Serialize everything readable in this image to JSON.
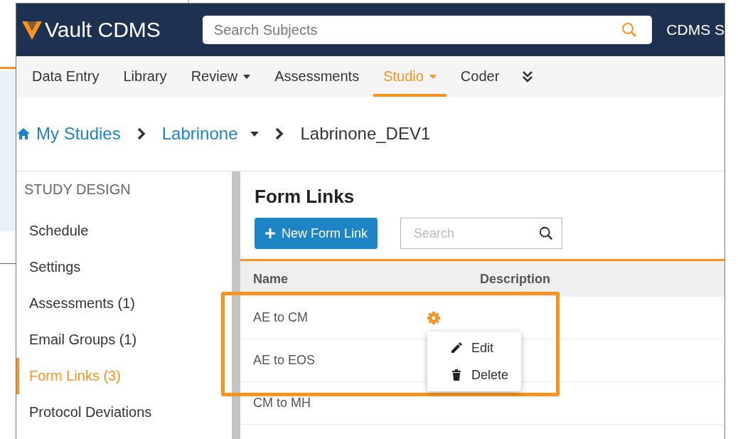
{
  "header": {
    "logo": "Vault CDMS",
    "search": {
      "placeholder": "Search Subjects"
    },
    "user_menu": "CDMS S"
  },
  "nav_tabs": [
    {
      "label": "Data Entry",
      "selected": false,
      "dropdown": false
    },
    {
      "label": "Library",
      "selected": false,
      "dropdown": false
    },
    {
      "label": "Review",
      "selected": false,
      "dropdown": true
    },
    {
      "label": "Assessments",
      "selected": false,
      "dropdown": false
    },
    {
      "label": "Studio",
      "selected": true,
      "dropdown": true
    },
    {
      "label": "Coder",
      "selected": false,
      "dropdown": false
    }
  ],
  "breadcrumb": [
    {
      "label": "My Studies",
      "kind": "home"
    },
    {
      "label": "Labrinone",
      "kind": "dropdown"
    },
    {
      "label": "Labrinone_DEV1",
      "kind": "current"
    }
  ],
  "sidebar": {
    "heading": "STUDY DESIGN",
    "items": [
      {
        "label": "Schedule",
        "selected": false
      },
      {
        "label": "Settings",
        "selected": false
      },
      {
        "label": "Assessments (1)",
        "selected": false
      },
      {
        "label": "Email Groups (1)",
        "selected": false
      },
      {
        "label": "Form Links (3)",
        "selected": true
      },
      {
        "label": "Protocol Deviations",
        "selected": false
      }
    ]
  },
  "content": {
    "title": "Form Links",
    "new_button": "New Form Link",
    "search": {
      "placeholder": "Search"
    },
    "table": {
      "columns": [
        "Name",
        "Description"
      ],
      "rows": [
        {
          "name": "AE to CM",
          "hovered": true
        },
        {
          "name": "AE to EOS",
          "hovered": false
        },
        {
          "name": "CM to MH",
          "hovered": false
        }
      ]
    },
    "context_menu": [
      {
        "label": "Edit",
        "kind": "edit"
      },
      {
        "label": "Delete",
        "kind": "delete"
      }
    ]
  }
}
